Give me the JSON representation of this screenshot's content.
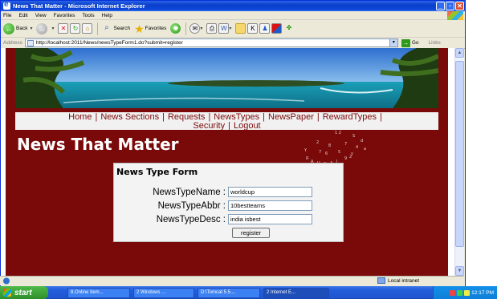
{
  "window": {
    "title": "News That Matter - Microsoft Internet Explorer",
    "min_label": "_",
    "max_label": "▫",
    "close_label": "✕"
  },
  "menu": [
    "File",
    "Edit",
    "View",
    "Favorites",
    "Tools",
    "Help"
  ],
  "toolbar": {
    "back_label": "Back",
    "search_label": "Search",
    "favorites_label": "Favorites"
  },
  "address": {
    "label": "Address",
    "url": "http://localhost:2011/News/newsTypeForm1.do?submit=register",
    "go_label": "Go",
    "links_label": "Links"
  },
  "site": {
    "nav_row1": [
      "Home",
      "News Sections",
      "Requests",
      "NewsTypes",
      "NewsPaper",
      "RewardTypes"
    ],
    "nav_row2": [
      "Security",
      "Logout"
    ],
    "title": "News That Matter"
  },
  "form": {
    "title": "News Type Form",
    "fields": [
      {
        "label": "NewsTypeName :",
        "value": "worldcup"
      },
      {
        "label": "NewsTypeAbbr :",
        "value": "10bestteams"
      },
      {
        "label": "NewsTypeDesc :",
        "value": "india isbest"
      }
    ],
    "submit_label": "register"
  },
  "status": {
    "zone": "Local intranet"
  },
  "taskbar": {
    "start_label": "start",
    "tasks": [
      "8.Online Item...",
      "2 Windows ...",
      "D:\\Tomcat 5.5....",
      "2 Internet E..."
    ],
    "clock": "12:17 PM"
  },
  "colors": {
    "page_bg": "#7a0a0a",
    "nav_bg": "#f1f1f1",
    "form_bg": "#f3f3f3",
    "title_bar": "#0a3fc9",
    "taskbar": "#245edb"
  }
}
